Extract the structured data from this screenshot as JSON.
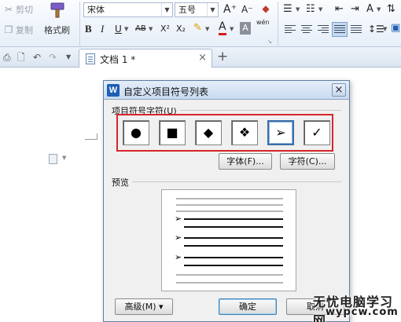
{
  "ribbon": {
    "clipboard": {
      "cut": "剪切",
      "copy": "复制",
      "format_painter": "格式刷"
    },
    "font_name": "宋体",
    "font_size": "五号",
    "grow_font": "A⁺",
    "shrink_font": "A⁻",
    "bold": "B",
    "italic": "I",
    "underline": "U",
    "strikethrough": "AB",
    "superscript": "X²",
    "subscript": "X₂",
    "font_color": "A",
    "char_shading": "A",
    "phonetic": "wén"
  },
  "tabbar": {
    "document_tab": "文档 1 *",
    "close_symbol": "×",
    "new_tab_symbol": "+"
  },
  "dialog": {
    "title": "自定义项目符号列表",
    "close_symbol": "×",
    "bullet_group_label": "项目符号字符(U)",
    "bullets": [
      {
        "symbol": "●",
        "selected": false
      },
      {
        "symbol": "■",
        "selected": false
      },
      {
        "symbol": "◆",
        "selected": false
      },
      {
        "symbol": "❖",
        "selected": false
      },
      {
        "symbol": "➢",
        "selected": true
      },
      {
        "symbol": "✓",
        "selected": false
      }
    ],
    "font_button": "字体(F)...",
    "char_button": "字符(C)...",
    "preview_label": "预览",
    "advanced_button": "高级(M) ▾",
    "ok_button": "确定",
    "cancel_button": "取消"
  },
  "watermark": {
    "line1": "无忧电脑学习网",
    "line2": "wypcw.com"
  },
  "colors": {
    "highlight_border": "#d6262b",
    "accent": "#3b6ea8",
    "ribbon_bg": "#e6eef8"
  }
}
